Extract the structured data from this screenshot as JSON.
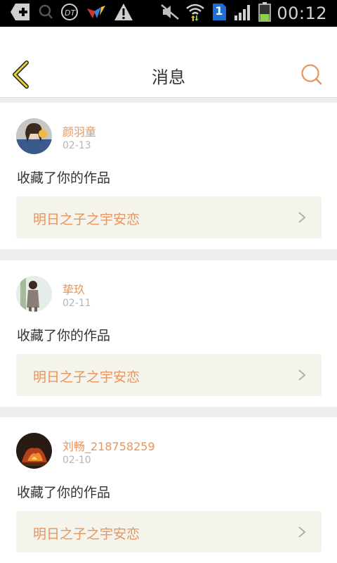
{
  "status_bar": {
    "time": "00:12",
    "sim_badge": "1",
    "icons": [
      "plus-notification-icon",
      "search-notification-icon",
      "app-notification-icon",
      "pinwheel-notification-icon",
      "warning-icon",
      "mute-icon",
      "wifi-icon",
      "sim-icon",
      "signal-icon",
      "battery-icon"
    ]
  },
  "header": {
    "title": "消息",
    "back_icon": "chevron-left-icon",
    "search_icon": "search-icon",
    "accent": "#e8955a",
    "back_color": "#e6d235"
  },
  "messages": [
    {
      "username": "颜羽童",
      "date": "02-13",
      "action": "收藏了你的作品",
      "work_title": "明日之子之宇安恋"
    },
    {
      "username": "挚玖",
      "date": "02-11",
      "action": "收藏了你的作品",
      "work_title": "明日之子之宇安恋"
    },
    {
      "username": "刘畅_218758259",
      "date": "02-10",
      "action": "收藏了你的作品",
      "work_title": "明日之子之宇安恋"
    }
  ]
}
